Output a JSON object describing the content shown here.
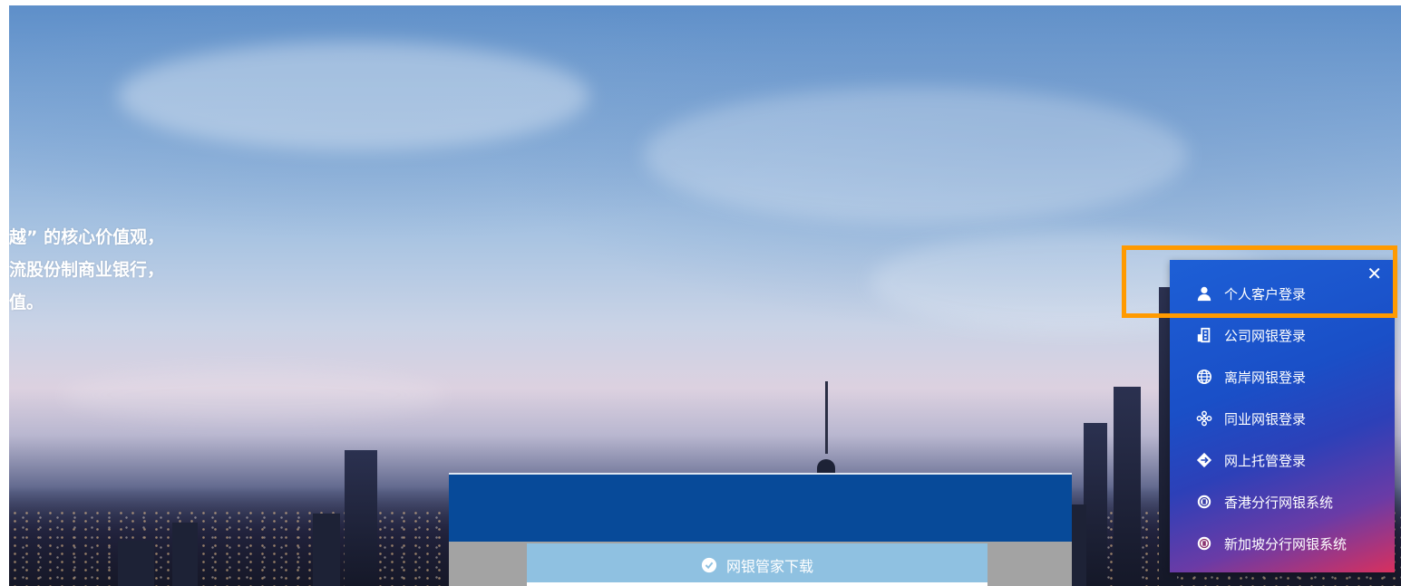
{
  "hero": {
    "slogan_lines": [
      "越” 的核心价值观，",
      "流股份制商业银行，",
      "值。"
    ]
  },
  "login_menu": {
    "close_symbol": "✕",
    "items": [
      {
        "label": "个人客户登录",
        "icon": "user-icon"
      },
      {
        "label": "公司网银登录",
        "icon": "building-icon"
      },
      {
        "label": "离岸网银登录",
        "icon": "globe-icon"
      },
      {
        "label": "同业网银登录",
        "icon": "network-icon"
      },
      {
        "label": "网上托管登录",
        "icon": "diamond-icon"
      },
      {
        "label": "香港分行网银系统",
        "icon": "hk-branch-icon"
      },
      {
        "label": "新加坡分行网银系统",
        "icon": "sg-branch-icon"
      }
    ],
    "highlight_color": "#ff9a00"
  },
  "download": {
    "label": "网银管家下载",
    "icon": "shield-check-icon"
  },
  "colors": {
    "menu_gradient_start": "#1d5fd6",
    "menu_gradient_end": "#d8305e",
    "download_top": "#074a99",
    "download_bar": "#8fc1e1"
  }
}
